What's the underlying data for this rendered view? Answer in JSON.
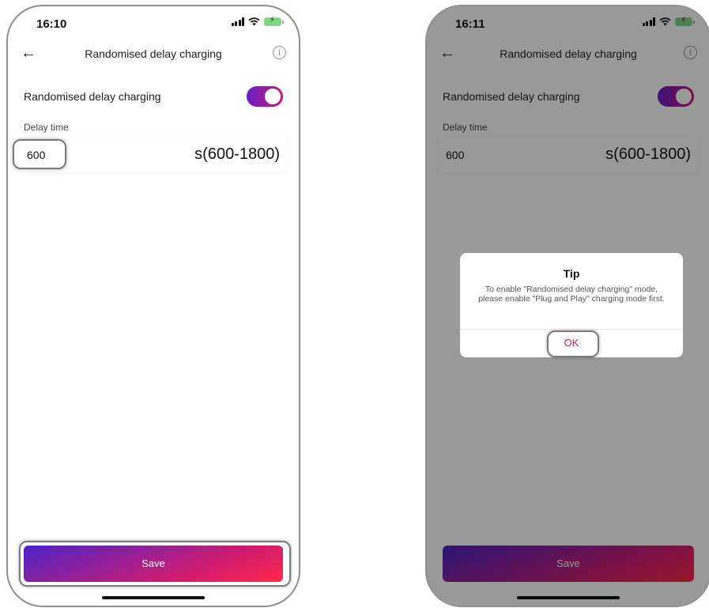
{
  "left_screen": {
    "status_time": "16:10",
    "nav_title": "Randomised delay charging",
    "setting_label": "Randomised delay charging",
    "toggle_on": true,
    "delay_label": "Delay time",
    "delay_value": "600",
    "delay_range": "s(600-1800)",
    "save_label": "Save"
  },
  "right_screen": {
    "status_time": "16:11",
    "nav_title": "Randomised delay charging",
    "setting_label": "Randomised delay charging",
    "toggle_on": true,
    "delay_label": "Delay time",
    "delay_value": "600",
    "delay_range": "s(600-1800)",
    "save_label": "Save",
    "dialog": {
      "title": "Tip",
      "message": "To enable \"Randomised delay charging\" mode, please enable \"Plug and Play\" charging mode first.",
      "ok_label": "OK"
    }
  },
  "icons": {
    "back": "back-arrow-icon",
    "info": "info-icon",
    "signal": "signal-icon",
    "wifi": "wifi-icon",
    "battery": "battery-charging-icon"
  },
  "colors": {
    "accent_start": "#6a1ec8",
    "accent_end": "#ff2a48",
    "ok_text": "#c11a5c"
  }
}
